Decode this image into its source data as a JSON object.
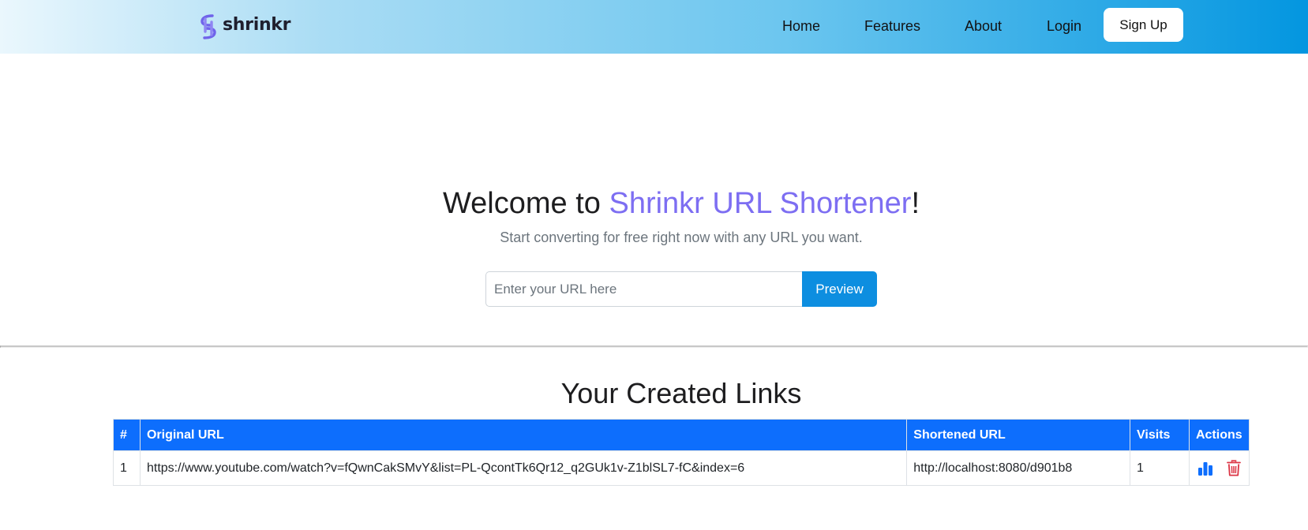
{
  "navbar": {
    "brand": "shrinkr",
    "links": [
      {
        "label": "Home"
      },
      {
        "label": "Features"
      },
      {
        "label": "About"
      },
      {
        "label": "Login"
      }
    ],
    "signup_label": "Sign Up",
    "gradient_colors": [
      "#eaf7fd",
      "#0396e0"
    ]
  },
  "hero": {
    "title_prefix": "Welcome to ",
    "title_accent": "Shrinkr URL Shortener",
    "title_suffix": "!",
    "accent_color": "#7d6ef2",
    "subtitle": "Start converting for free right now with any URL you want.",
    "input_placeholder": "Enter your URL here",
    "input_value": "",
    "preview_label": "Preview"
  },
  "links_section": {
    "title": "Your Created Links",
    "columns": [
      "#",
      "Original URL",
      "Shortened URL",
      "Visits",
      "Actions"
    ],
    "rows": [
      {
        "num": "1",
        "original": "https://www.youtube.com/watch?v=fQwnCakSMvY&list=PL-QcontTk6Qr12_q2GUk1v-Z1blSL7-fC&index=6",
        "short": "http://localhost:8080/d901b8",
        "visits": "1",
        "actions": [
          "bar-chart-icon",
          "trash-icon"
        ]
      }
    ],
    "header_color": "#0d6efd",
    "stats_icon_color": "#0d6efd",
    "delete_icon_color": "#dc3545"
  }
}
